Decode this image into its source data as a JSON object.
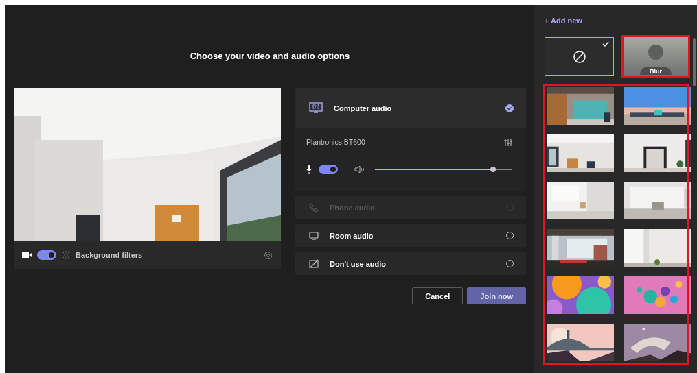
{
  "title": "Choose your video and audio options",
  "video": {
    "camera_on": true,
    "filters_label": "Background filters"
  },
  "audio": {
    "options": [
      {
        "kind": "computer",
        "label": "Computer audio",
        "selected": true,
        "disabled": false
      },
      {
        "kind": "phone",
        "label": "Phone audio",
        "selected": false,
        "disabled": true
      },
      {
        "kind": "room",
        "label": "Room audio",
        "selected": false,
        "disabled": false
      },
      {
        "kind": "none",
        "label": "Don't use audio",
        "selected": false,
        "disabled": false
      }
    ],
    "device": "Plantronics BT600",
    "mic_on": true,
    "speaker": {
      "level": 0.86
    }
  },
  "buttons": [
    {
      "kind": "secondary",
      "label": "Cancel"
    },
    {
      "kind": "primary",
      "label": "Join now"
    }
  ],
  "sidebar": {
    "add_new": "+ Add new",
    "effects": [
      {
        "kind": "none",
        "selected": true,
        "highlighted": false
      },
      {
        "kind": "blur",
        "label": "Blur",
        "selected": false,
        "highlighted": true
      }
    ],
    "backgrounds_highlighted": true
  }
}
